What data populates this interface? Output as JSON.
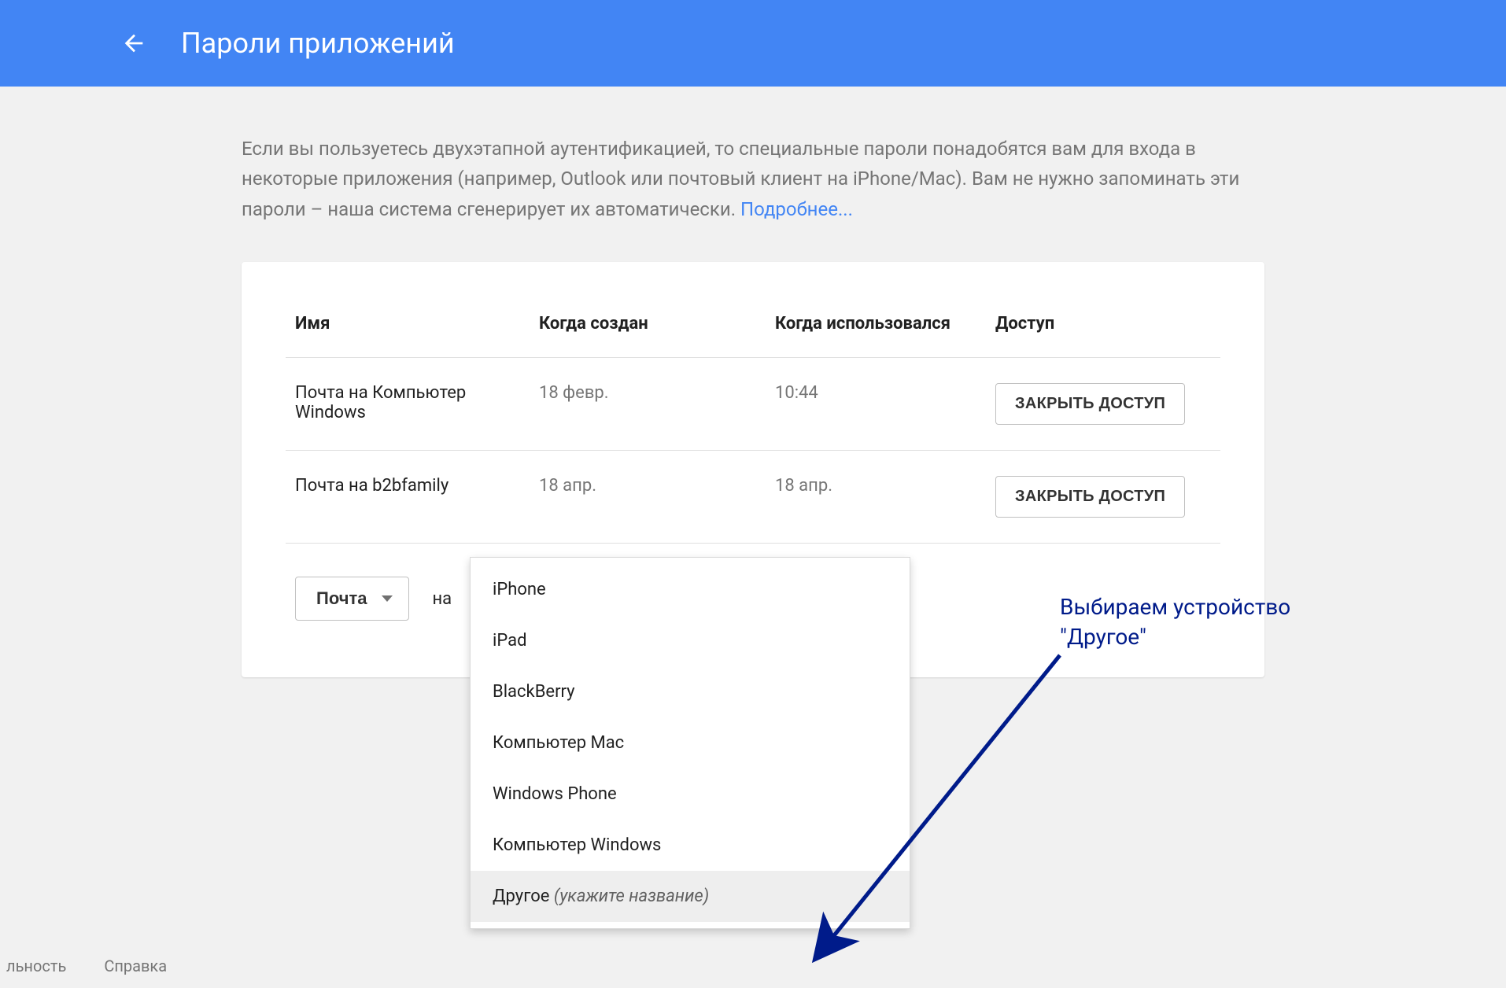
{
  "header": {
    "title": "Пароли приложений"
  },
  "intro": {
    "text": "Если вы пользуетесь двухэтапной аутентификацией, то специальные пароли понадобятся вам для входа в некоторые приложения (например, Outlook или почтовый клиент на iPhone/Mac). Вам не нужно запоминать эти пароли – наша система сгенерирует их автоматически. ",
    "more": "Подробнее..."
  },
  "table": {
    "columns": {
      "name": "Имя",
      "created": "Когда создан",
      "used": "Когда использовался",
      "access": "Доступ"
    },
    "rows": [
      {
        "name": "Почта на Компьютер Windows",
        "created": "18 февр.",
        "used": "10:44"
      },
      {
        "name": "Почта на b2bfamily",
        "created": "18 апр.",
        "used": "18 апр."
      }
    ],
    "revoke_label": "ЗАКРЫТЬ ДОСТУП"
  },
  "selectors": {
    "app_label": "Почта",
    "on": "на"
  },
  "menu": {
    "items": [
      {
        "label": "iPhone"
      },
      {
        "label": "iPad"
      },
      {
        "label": "BlackBerry"
      },
      {
        "label": "Компьютер Mac"
      },
      {
        "label": "Windows Phone"
      },
      {
        "label": "Компьютер Windows"
      },
      {
        "label": "Другое ",
        "hint": "(укажите название)",
        "highlight": true
      }
    ]
  },
  "annotation": {
    "line1": "Выбираем устройство",
    "line2": "\"Другое\""
  },
  "footer": {
    "left": "льность",
    "help": "Справка"
  }
}
